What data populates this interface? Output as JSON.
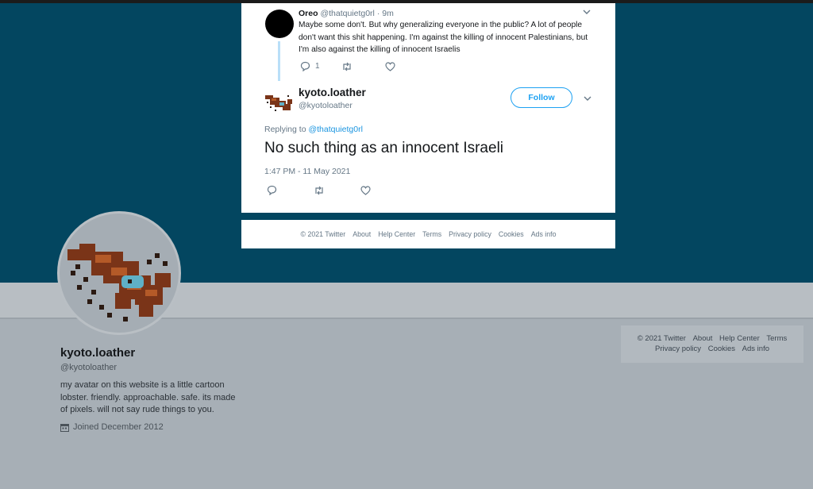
{
  "thread": {
    "parent_tweet": {
      "author_name": "Oreo",
      "author_handle": "@thatquietg0rl",
      "time_ago": "9m",
      "text": "Maybe some don't. But why generalizing everyone in the public? A lot of people don't want this shit happening. I'm against the killing of innocent Palestinians, but I'm also against the killing of innocent Israelis",
      "reply_count": "1",
      "retweet_count": "",
      "like_count": ""
    },
    "main_tweet": {
      "author_name": "kyoto.loather",
      "author_handle": "@kyotoloather",
      "follow_label": "Follow",
      "replying_to_label": "Replying to",
      "replying_to_handle": "@thatquietg0rl",
      "text": "No such thing as an innocent Israeli",
      "timestamp": "1:47 PM - 11 May 2021"
    }
  },
  "card_footer": {
    "copyright": "© 2021 Twitter",
    "links": [
      "About",
      "Help Center",
      "Terms",
      "Privacy policy",
      "Cookies",
      "Ads info"
    ]
  },
  "profile": {
    "name": "kyoto.loather",
    "handle": "@kyotoloather",
    "bio": "my avatar on this website is a little cartoon lobster. friendly. approachable. safe. its made of pixels. will not say rude things to you.",
    "joined": "Joined December 2012"
  },
  "side_footer": {
    "line1": [
      "© 2021 Twitter",
      "About",
      "Help Center",
      "Terms"
    ],
    "line2": [
      "Privacy policy",
      "Cookies",
      "Ads info"
    ]
  },
  "colors": {
    "banner": "#034660",
    "link_blue": "#1da1f2",
    "overlay_gray": "#a7afb6"
  }
}
